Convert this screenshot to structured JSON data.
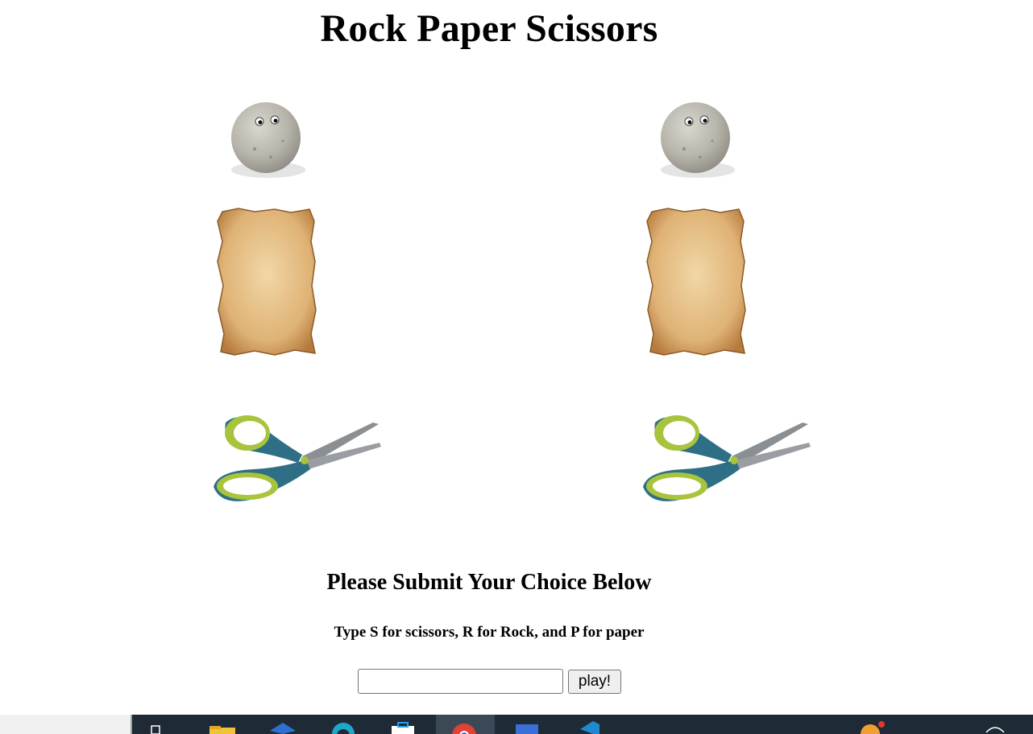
{
  "page": {
    "title": "Rock Paper Scissors",
    "prompt_heading": "Please Submit Your Choice Below",
    "instructions": "Type S for scissors, R for Rock, and P for paper"
  },
  "choices": [
    {
      "name": "rock"
    },
    {
      "name": "paper"
    },
    {
      "name": "scissors"
    }
  ],
  "form": {
    "input_value": "",
    "input_placeholder": "",
    "play_label": "play!"
  },
  "taskbar": {
    "icons": [
      "task-view-icon",
      "file-explorer-icon",
      "dropbox-icon",
      "edge-icon",
      "store-icon",
      "chrome-icon",
      "word-icon",
      "vscode-icon",
      "notification-icon"
    ]
  },
  "colors": {
    "background": "#ffffff",
    "taskbar": "#1e2a36",
    "scissors_blade": "#8a8f93",
    "scissors_handle": "#a8c43c",
    "scissors_body": "#2f6f86",
    "paper": "#e8c08a",
    "rock": "#bfbdb5"
  }
}
